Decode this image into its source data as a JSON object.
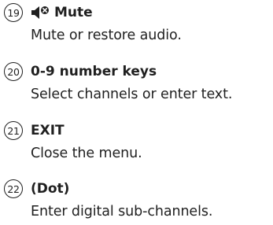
{
  "entries": [
    {
      "number": "19",
      "icon": "mute-icon",
      "title": "Mute",
      "description": "Mute or restore audio."
    },
    {
      "number": "20",
      "title": "0-9 number keys",
      "description": "Select channels or enter text."
    },
    {
      "number": "21",
      "title": "EXIT",
      "description": "Close the menu."
    },
    {
      "number": "22",
      "title": "(Dot)",
      "description": "Enter digital sub-channels."
    }
  ]
}
